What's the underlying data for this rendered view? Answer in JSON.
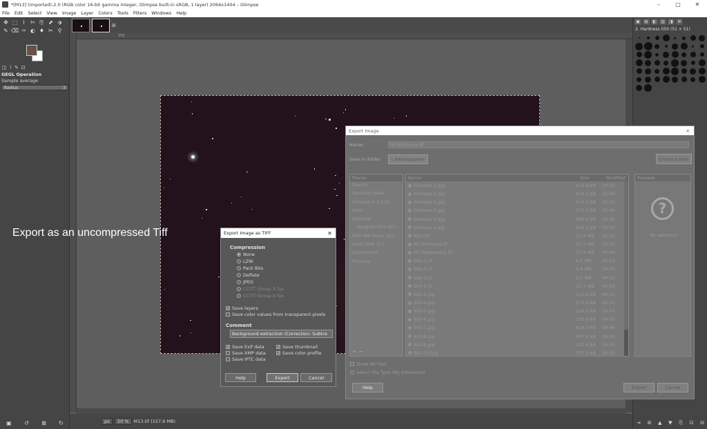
{
  "window": {
    "title": "*[M13] (imported)-2.0 (RGB color 16-bit gamma integer, Glimpse built-in sRGB, 1 layer) 2064x1404 – Glimpse",
    "controls": [
      "–",
      "□",
      "✕"
    ]
  },
  "menu": [
    "File",
    "Edit",
    "Select",
    "View",
    "Image",
    "Layer",
    "Colors",
    "Tools",
    "Filters",
    "Windows",
    "Help"
  ],
  "toolbox": {
    "tools": [
      "✥",
      "⬚",
      "⌇",
      "✄",
      "⎘",
      "⬈",
      "⬗",
      "✎",
      "⌫",
      "✑",
      "◐",
      "♦",
      "✂",
      "⚲"
    ],
    "colors": {
      "foreground": "#6b4f4a",
      "background": "#ffffff"
    },
    "panel_tabs": [
      "◫",
      "⌇",
      "✎",
      "⊡"
    ],
    "gegl": {
      "title": "GEGL Operation",
      "sample_label": "Sample average",
      "radius_label": "Radius",
      "radius_value": "3"
    },
    "bottom_icons": [
      "▣",
      "↺",
      "⊠",
      "↻"
    ]
  },
  "canvas": {
    "overlay_text": "Export as an uncompressed Tiff",
    "ruler_mark": "250"
  },
  "statusbar": {
    "unit": "px",
    "zoom": "50 %",
    "info": "M13.tif (157.9 MB)"
  },
  "rightdock": {
    "brush_label": "2. Hardness 050 (51 × 51)",
    "tabs": [
      "▣",
      "▤",
      "◧",
      "▥",
      "◨",
      "⊞"
    ],
    "bottom_icons": [
      "⇥",
      "⊞",
      "▲",
      "▼",
      "⎘",
      "⊡",
      "⊟"
    ]
  },
  "export_dialog": {
    "title": "Export Image",
    "name_label": "Name:",
    "name_value": "M13Glimpse.tif",
    "folder_label": "Save in folder:",
    "folder_value": "AASequator",
    "create_folder": "Create Folder",
    "places_header": "Places",
    "places": [
      {
        "label": "Search",
        "indent": false
      },
      {
        "label": "Recently Used",
        "indent": false
      },
      {
        "label": "Glimpse 0.2.0 (6...",
        "indent": false
      },
      {
        "label": "User",
        "indent": false
      },
      {
        "label": "Desktop",
        "indent": false
      },
      {
        "label": "Seagate Slim Dri...",
        "indent": true
      },
      {
        "label": "DVD RW Drive (D:)",
        "indent": false
      },
      {
        "label": "Local Disk (C:)",
        "indent": false
      },
      {
        "label": "Documents",
        "indent": false
      },
      {
        "label": "Pictures",
        "indent": false
      }
    ],
    "columns": {
      "name": "Name",
      "size": "Size",
      "modified": "Modified"
    },
    "files": [
      {
        "name": "Glimpse-1.jpg",
        "size": "612.8 kB",
        "modified": "10:10"
      },
      {
        "name": "Glimpse-2.jpg",
        "size": "678.2 kB",
        "modified": "10:28"
      },
      {
        "name": "Glimpse-3.jpg",
        "size": "674.1 kB",
        "modified": "10:32"
      },
      {
        "name": "Glimpse-7.jpg",
        "size": "671.5 kB",
        "modified": "10:46"
      },
      {
        "name": "Glimpse-6.jpg",
        "size": "666.0 kB",
        "modified": "10:35"
      },
      {
        "name": "Glimpse.4.jpg",
        "size": "654.1 kB",
        "modified": "10:34"
      },
      {
        "name": "M13.tif",
        "size": "17.4 MB",
        "modified": "10:05"
      },
      {
        "name": "M13Glimpse.tif",
        "size": "23.3 MB",
        "modified": "10:20"
      },
      {
        "name": "M13Sequator2.tif",
        "size": "17.4 MB",
        "modified": "09:09"
      },
      {
        "name": "Seq-1.tif",
        "size": "6.7 MB",
        "modified": "08:53"
      },
      {
        "name": "Seq-2.tif",
        "size": "6.9 MB",
        "modified": "09:01"
      },
      {
        "name": "Seq-3.tif",
        "size": "6.7 MB",
        "modified": "09:05"
      },
      {
        "name": "Sirll-1.tif",
        "size": "13.3 MB",
        "modified": "09:16"
      },
      {
        "name": "Sirll-3.jpg",
        "size": "523.6 kB",
        "modified": "09:31"
      },
      {
        "name": "Sirll-4.jpg",
        "size": "275.6 kB",
        "modified": "09:21"
      },
      {
        "name": "Sirll-5.jpg",
        "size": "516.5 kB",
        "modified": "09:54"
      },
      {
        "name": "Sirll-6.jpg",
        "size": "356.0 kB",
        "modified": "09:55"
      },
      {
        "name": "Sirll-7.jpg",
        "size": "628.3 kB",
        "modified": "09:46"
      },
      {
        "name": "Sirll-8.jpg",
        "size": "407.4 kB",
        "modified": "09:58"
      },
      {
        "name": "Sirll-9.jpg",
        "size": "507.6 kB",
        "modified": "10:03"
      },
      {
        "name": "Sirll-10.jpg",
        "size": "707.3 kB",
        "modified": "10:05"
      }
    ],
    "preview_header": "Preview",
    "no_selection": "No selection",
    "show_all_files": "Show All Files",
    "select_file_type": "Select File Type (By Extension)",
    "help": "Help",
    "export": "Export",
    "cancel": "Cancel"
  },
  "tiff_dialog": {
    "title": "Export Image as TIFF",
    "compression_header": "Compression",
    "options": [
      {
        "label": "None",
        "selected": true,
        "disabled": false
      },
      {
        "label": "LZW",
        "selected": false,
        "disabled": false
      },
      {
        "label": "Pack Bits",
        "selected": false,
        "disabled": false
      },
      {
        "label": "Deflate",
        "selected": false,
        "disabled": false
      },
      {
        "label": "JPEG",
        "selected": false,
        "disabled": false
      },
      {
        "label": "CCITT Group 3 fax",
        "selected": false,
        "disabled": true
      },
      {
        "label": "CCITT Group 4 fax",
        "selected": false,
        "disabled": true
      }
    ],
    "save_layers": "Save layers",
    "save_color_values": "Save color values from transparent pixels",
    "comment_header": "Comment",
    "comment_value": "Background extraction (Correction: Subtra",
    "save_exif": "Save Exif data",
    "save_thumbnail": "Save thumbnail",
    "save_xmp": "Save XMP data",
    "save_color_profile": "Save color profile",
    "save_iptc": "Save IPTC data",
    "help": "Help",
    "export": "Export",
    "cancel": "Cancel"
  }
}
